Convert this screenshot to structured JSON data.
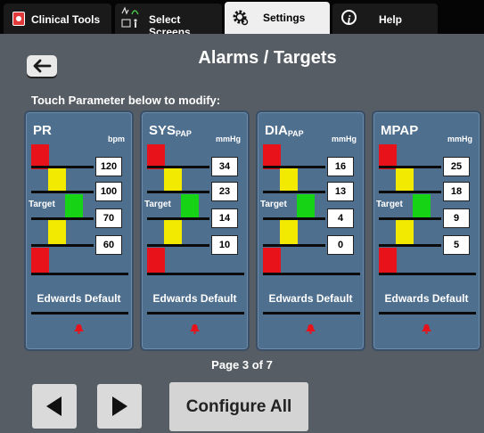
{
  "tabs": {
    "clinical_tools": "Clinical Tools",
    "select_screens": "Select Screens",
    "settings": "Settings",
    "help": "Help"
  },
  "header": {
    "title": "Alarms / Targets"
  },
  "instruction": "Touch Parameter below to modify:",
  "target_label": "Target",
  "panels": [
    {
      "name": "PR",
      "sub": "",
      "unit": "bpm",
      "values": [
        "120",
        "100",
        "70",
        "60"
      ],
      "default": "Edwards Default"
    },
    {
      "name": "SYS",
      "sub": "PAP",
      "unit": "mmHg",
      "values": [
        "34",
        "23",
        "14",
        "10"
      ],
      "default": "Edwards Default"
    },
    {
      "name": "DIA",
      "sub": "PAP",
      "unit": "mmHg",
      "values": [
        "16",
        "13",
        "4",
        "0"
      ],
      "default": "Edwards Default"
    },
    {
      "name": "MPAP",
      "sub": "",
      "unit": "mmHg",
      "values": [
        "25",
        "18",
        "9",
        "5"
      ],
      "default": "Edwards Default"
    }
  ],
  "pagination": {
    "text": "Page 3 of 7"
  },
  "buttons": {
    "configure_all": "Configure All"
  },
  "icons": {
    "clinical_tools": "medkit-icon",
    "select_screens": "screens-icon",
    "settings": "gear-icon",
    "help": "info-icon",
    "back": "back-arrow-icon",
    "alarm": "bell-icon",
    "prev": "triangle-left-icon",
    "next": "triangle-right-icon"
  },
  "colors": {
    "alarm_red": "#e8121b",
    "warning_yellow": "#f2ea00",
    "target_green": "#16d316",
    "panel_blue": "#4f6f8f"
  }
}
